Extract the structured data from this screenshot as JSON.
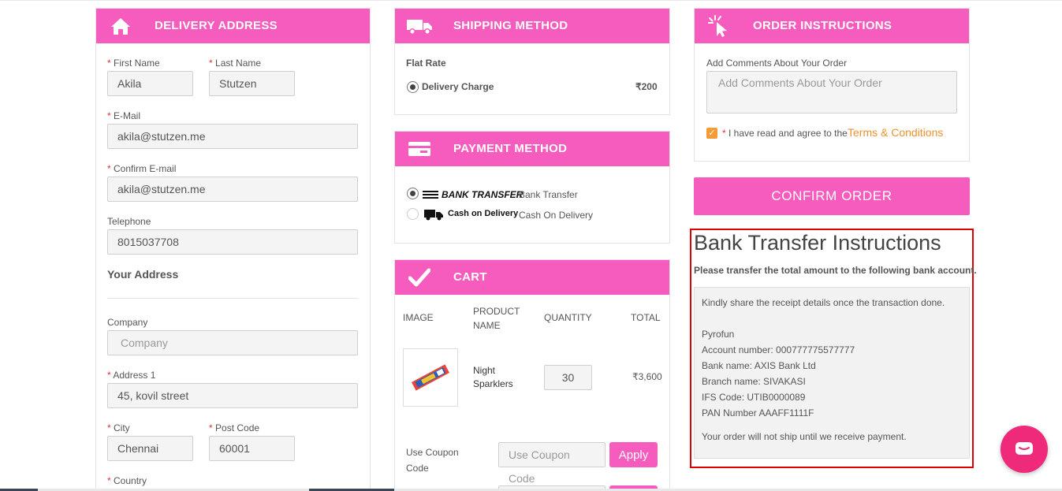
{
  "delivery": {
    "title": "DELIVERY ADDRESS",
    "first_name_label": "First Name",
    "first_name_value": "Akila",
    "last_name_label": "Last Name",
    "last_name_value": "Stutzen",
    "email_label": "E-Mail",
    "email_value": "akila@stutzen.me",
    "confirm_email_label": "Confirm E-mail",
    "confirm_email_value": "akila@stutzen.me",
    "telephone_label": "Telephone",
    "telephone_value": "8015037708",
    "your_address": "Your Address",
    "company_label": "Company",
    "company_placeholder": "Company",
    "address1_label": "Address 1",
    "address1_value": "45, kovil street",
    "city_label": "City",
    "city_value": "Chennai",
    "postcode_label": "Post Code",
    "postcode_value": "60001",
    "country_label": "Country",
    "required_mark": "*"
  },
  "shipping": {
    "title": "SHIPPING METHOD",
    "rate_name": "Flat Rate",
    "option_label": "Delivery Charge",
    "option_price": "₹200"
  },
  "payment": {
    "title": "PAYMENT METHOD",
    "options": [
      {
        "logo_text": "BANK TRANSFER",
        "label": "Bank Transfer",
        "selected": true
      },
      {
        "logo_text": "Cash on Delivery",
        "label": "Cash On Delivery",
        "selected": false
      }
    ]
  },
  "cart": {
    "title": "CART",
    "headers": {
      "image": "IMAGE",
      "product": "PRODUCT NAME",
      "quantity": "QUANTITY",
      "total": "TOTAL"
    },
    "items": [
      {
        "name_line1": "Night",
        "name_line2": "Sparklers",
        "quantity": "30",
        "total": "₹3,600"
      }
    ],
    "coupon_label_line1": "Use Coupon",
    "coupon_label_line2": "Code",
    "coupon_placeholder": "Use Coupon Code",
    "apply_label": "Apply"
  },
  "order_instructions": {
    "title": "ORDER INSTRUCTIONS",
    "comments_label": "Add Comments About Your Order",
    "comments_placeholder": "Add Comments About Your Order",
    "agree_text": "I have read and agree to the",
    "terms_link": "Terms & Conditions",
    "agreed": true
  },
  "confirm_label": "CONFIRM ORDER",
  "bank": {
    "title": "Bank Transfer Instructions",
    "subtitle": "Please transfer the total amount to the following bank account.",
    "lines": [
      "Kindly share the receipt details once the transaction done.",
      "Pyrofun",
      "Account number: 000777775577777",
      "Bank name: AXIS Bank Ltd",
      "Branch name: SIVAKASI",
      "IFS Code: UTIB0000089",
      "PAN Number AAAFF1111F",
      "Your order will not ship until we receive payment."
    ]
  },
  "colors": {
    "accent": "#f65cbe",
    "checkbox": "#f59b35",
    "link": "#f0902e",
    "highlight_border": "#e10000",
    "chat": "#f02a7a"
  },
  "icons": [
    "home-icon",
    "truck-icon",
    "pointer-click-icon",
    "credit-card-icon",
    "checkmark-icon",
    "chat-icon"
  ]
}
